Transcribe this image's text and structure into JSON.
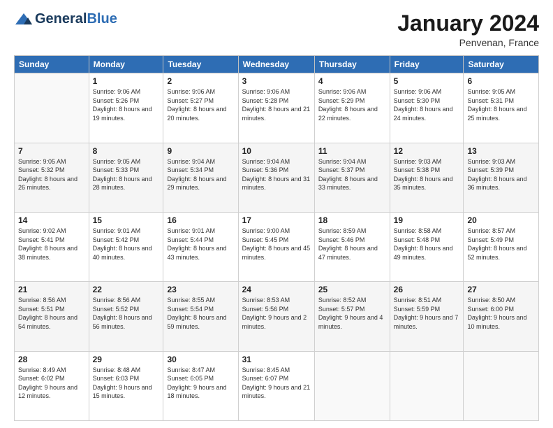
{
  "logo": {
    "general": "General",
    "blue": "Blue"
  },
  "title": "January 2024",
  "subtitle": "Penvenan, France",
  "days_header": [
    "Sunday",
    "Monday",
    "Tuesday",
    "Wednesday",
    "Thursday",
    "Friday",
    "Saturday"
  ],
  "weeks": [
    [
      {
        "day": "",
        "sunrise": "",
        "sunset": "",
        "daylight": ""
      },
      {
        "day": "1",
        "sunrise": "Sunrise: 9:06 AM",
        "sunset": "Sunset: 5:26 PM",
        "daylight": "Daylight: 8 hours and 19 minutes."
      },
      {
        "day": "2",
        "sunrise": "Sunrise: 9:06 AM",
        "sunset": "Sunset: 5:27 PM",
        "daylight": "Daylight: 8 hours and 20 minutes."
      },
      {
        "day": "3",
        "sunrise": "Sunrise: 9:06 AM",
        "sunset": "Sunset: 5:28 PM",
        "daylight": "Daylight: 8 hours and 21 minutes."
      },
      {
        "day": "4",
        "sunrise": "Sunrise: 9:06 AM",
        "sunset": "Sunset: 5:29 PM",
        "daylight": "Daylight: 8 hours and 22 minutes."
      },
      {
        "day": "5",
        "sunrise": "Sunrise: 9:06 AM",
        "sunset": "Sunset: 5:30 PM",
        "daylight": "Daylight: 8 hours and 24 minutes."
      },
      {
        "day": "6",
        "sunrise": "Sunrise: 9:05 AM",
        "sunset": "Sunset: 5:31 PM",
        "daylight": "Daylight: 8 hours and 25 minutes."
      }
    ],
    [
      {
        "day": "7",
        "sunrise": "Sunrise: 9:05 AM",
        "sunset": "Sunset: 5:32 PM",
        "daylight": "Daylight: 8 hours and 26 minutes."
      },
      {
        "day": "8",
        "sunrise": "Sunrise: 9:05 AM",
        "sunset": "Sunset: 5:33 PM",
        "daylight": "Daylight: 8 hours and 28 minutes."
      },
      {
        "day": "9",
        "sunrise": "Sunrise: 9:04 AM",
        "sunset": "Sunset: 5:34 PM",
        "daylight": "Daylight: 8 hours and 29 minutes."
      },
      {
        "day": "10",
        "sunrise": "Sunrise: 9:04 AM",
        "sunset": "Sunset: 5:36 PM",
        "daylight": "Daylight: 8 hours and 31 minutes."
      },
      {
        "day": "11",
        "sunrise": "Sunrise: 9:04 AM",
        "sunset": "Sunset: 5:37 PM",
        "daylight": "Daylight: 8 hours and 33 minutes."
      },
      {
        "day": "12",
        "sunrise": "Sunrise: 9:03 AM",
        "sunset": "Sunset: 5:38 PM",
        "daylight": "Daylight: 8 hours and 35 minutes."
      },
      {
        "day": "13",
        "sunrise": "Sunrise: 9:03 AM",
        "sunset": "Sunset: 5:39 PM",
        "daylight": "Daylight: 8 hours and 36 minutes."
      }
    ],
    [
      {
        "day": "14",
        "sunrise": "Sunrise: 9:02 AM",
        "sunset": "Sunset: 5:41 PM",
        "daylight": "Daylight: 8 hours and 38 minutes."
      },
      {
        "day": "15",
        "sunrise": "Sunrise: 9:01 AM",
        "sunset": "Sunset: 5:42 PM",
        "daylight": "Daylight: 8 hours and 40 minutes."
      },
      {
        "day": "16",
        "sunrise": "Sunrise: 9:01 AM",
        "sunset": "Sunset: 5:44 PM",
        "daylight": "Daylight: 8 hours and 43 minutes."
      },
      {
        "day": "17",
        "sunrise": "Sunrise: 9:00 AM",
        "sunset": "Sunset: 5:45 PM",
        "daylight": "Daylight: 8 hours and 45 minutes."
      },
      {
        "day": "18",
        "sunrise": "Sunrise: 8:59 AM",
        "sunset": "Sunset: 5:46 PM",
        "daylight": "Daylight: 8 hours and 47 minutes."
      },
      {
        "day": "19",
        "sunrise": "Sunrise: 8:58 AM",
        "sunset": "Sunset: 5:48 PM",
        "daylight": "Daylight: 8 hours and 49 minutes."
      },
      {
        "day": "20",
        "sunrise": "Sunrise: 8:57 AM",
        "sunset": "Sunset: 5:49 PM",
        "daylight": "Daylight: 8 hours and 52 minutes."
      }
    ],
    [
      {
        "day": "21",
        "sunrise": "Sunrise: 8:56 AM",
        "sunset": "Sunset: 5:51 PM",
        "daylight": "Daylight: 8 hours and 54 minutes."
      },
      {
        "day": "22",
        "sunrise": "Sunrise: 8:56 AM",
        "sunset": "Sunset: 5:52 PM",
        "daylight": "Daylight: 8 hours and 56 minutes."
      },
      {
        "day": "23",
        "sunrise": "Sunrise: 8:55 AM",
        "sunset": "Sunset: 5:54 PM",
        "daylight": "Daylight: 8 hours and 59 minutes."
      },
      {
        "day": "24",
        "sunrise": "Sunrise: 8:53 AM",
        "sunset": "Sunset: 5:56 PM",
        "daylight": "Daylight: 9 hours and 2 minutes."
      },
      {
        "day": "25",
        "sunrise": "Sunrise: 8:52 AM",
        "sunset": "Sunset: 5:57 PM",
        "daylight": "Daylight: 9 hours and 4 minutes."
      },
      {
        "day": "26",
        "sunrise": "Sunrise: 8:51 AM",
        "sunset": "Sunset: 5:59 PM",
        "daylight": "Daylight: 9 hours and 7 minutes."
      },
      {
        "day": "27",
        "sunrise": "Sunrise: 8:50 AM",
        "sunset": "Sunset: 6:00 PM",
        "daylight": "Daylight: 9 hours and 10 minutes."
      }
    ],
    [
      {
        "day": "28",
        "sunrise": "Sunrise: 8:49 AM",
        "sunset": "Sunset: 6:02 PM",
        "daylight": "Daylight: 9 hours and 12 minutes."
      },
      {
        "day": "29",
        "sunrise": "Sunrise: 8:48 AM",
        "sunset": "Sunset: 6:03 PM",
        "daylight": "Daylight: 9 hours and 15 minutes."
      },
      {
        "day": "30",
        "sunrise": "Sunrise: 8:47 AM",
        "sunset": "Sunset: 6:05 PM",
        "daylight": "Daylight: 9 hours and 18 minutes."
      },
      {
        "day": "31",
        "sunrise": "Sunrise: 8:45 AM",
        "sunset": "Sunset: 6:07 PM",
        "daylight": "Daylight: 9 hours and 21 minutes."
      },
      {
        "day": "",
        "sunrise": "",
        "sunset": "",
        "daylight": ""
      },
      {
        "day": "",
        "sunrise": "",
        "sunset": "",
        "daylight": ""
      },
      {
        "day": "",
        "sunrise": "",
        "sunset": "",
        "daylight": ""
      }
    ]
  ]
}
